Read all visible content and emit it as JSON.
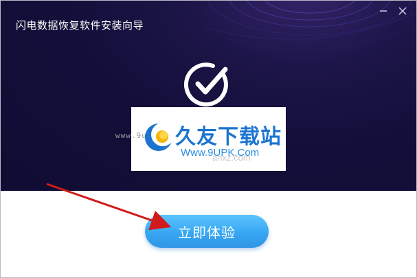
{
  "window": {
    "title": "闪电数据恢复软件安装向导",
    "minimize_icon": "minimize-icon",
    "close_icon": "close-icon"
  },
  "status": {
    "icon": "checkmark-circle-icon"
  },
  "watermark": {
    "url_partial": "www.9u",
    "url_partial_right": "com",
    "brand": "久友下载站",
    "site": "Www.9UPK.Com",
    "faint_text": "anxz.com",
    "logo_icon": "crescent-logo-icon"
  },
  "actions": {
    "primary_button": "立即体验"
  },
  "annotation": {
    "arrow_color": "#d11a1a"
  },
  "colors": {
    "hero_bg": "#130f3a",
    "button_top": "#5bc3ff",
    "button_bottom": "#2f95e4",
    "brand_blue": "#1b74d0"
  }
}
